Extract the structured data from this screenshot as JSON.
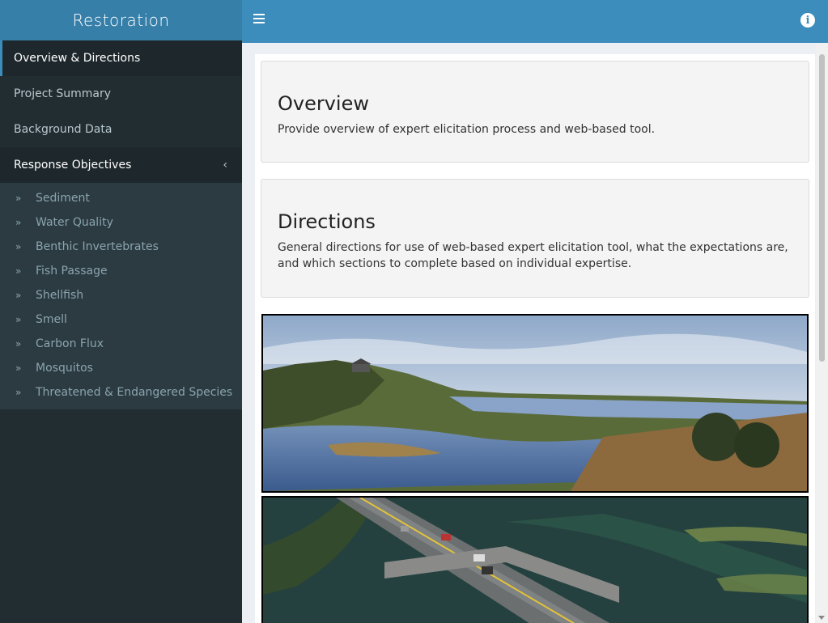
{
  "sidebar": {
    "brand": "Restoration",
    "menu": [
      {
        "label": "Overview & Directions"
      },
      {
        "label": "Project Summary"
      },
      {
        "label": "Background Data"
      },
      {
        "label": "Response Objectives"
      }
    ],
    "submenu": [
      {
        "label": "Sediment"
      },
      {
        "label": "Water Quality"
      },
      {
        "label": "Benthic Invertebrates"
      },
      {
        "label": "Fish Passage"
      },
      {
        "label": "Shellfish"
      },
      {
        "label": "Smell"
      },
      {
        "label": "Carbon Flux"
      },
      {
        "label": "Mosquitos"
      },
      {
        "label": "Threatened & Endangered Species"
      }
    ]
  },
  "header": {
    "menu_icon": "hamburger-icon",
    "info_icon": "info-icon",
    "info_glyph": "i"
  },
  "main": {
    "overview": {
      "title": "Overview",
      "text": "Provide overview of expert elicitation process and web-based tool."
    },
    "directions": {
      "title": "Directions",
      "text": "General directions for use of web-based expert elicitation tool, what the expectations are, and which sections to complete based on individual expertise."
    }
  },
  "colors": {
    "header": "#3c8dbc",
    "brand": "#367fa9",
    "sidebar": "#222d32",
    "submenu": "#2c3b41",
    "content_bg": "#ecf0f5"
  }
}
